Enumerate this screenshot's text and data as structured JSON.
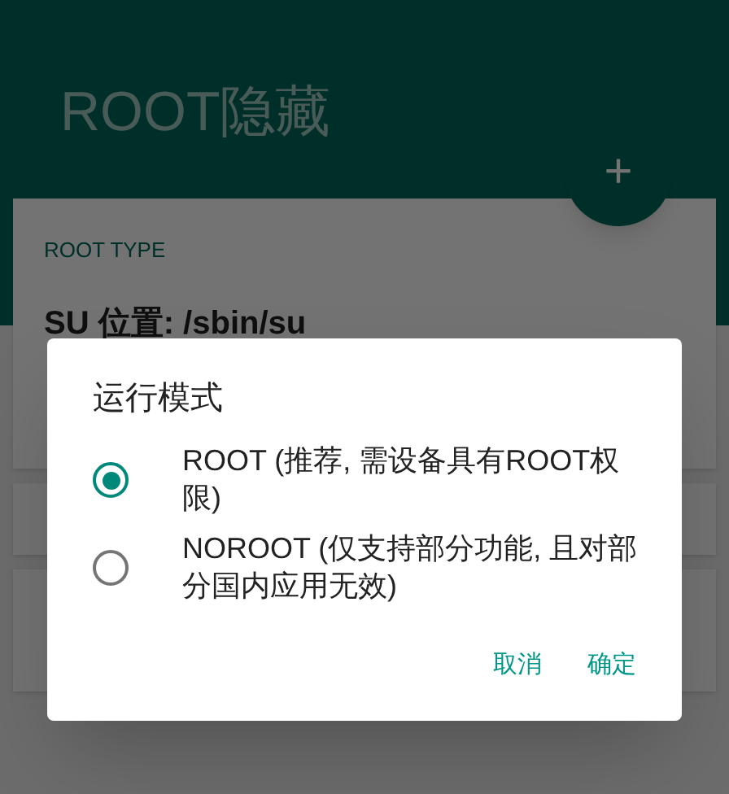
{
  "app_bar": {
    "title": "ROOT隐藏"
  },
  "fab": {
    "label": "+"
  },
  "card": {
    "section_label": "ROOT TYPE",
    "su_location": "SU 位置: /sbin/su"
  },
  "dialog": {
    "title": "运行模式",
    "options": [
      {
        "label": "ROOT (推荐, 需设备具有ROOT权限)",
        "selected": true
      },
      {
        "label": "NOROOT (仅支持部分功能, 且对部分国内应用无效)",
        "selected": false
      }
    ],
    "buttons": [
      "取消",
      "确定"
    ]
  }
}
